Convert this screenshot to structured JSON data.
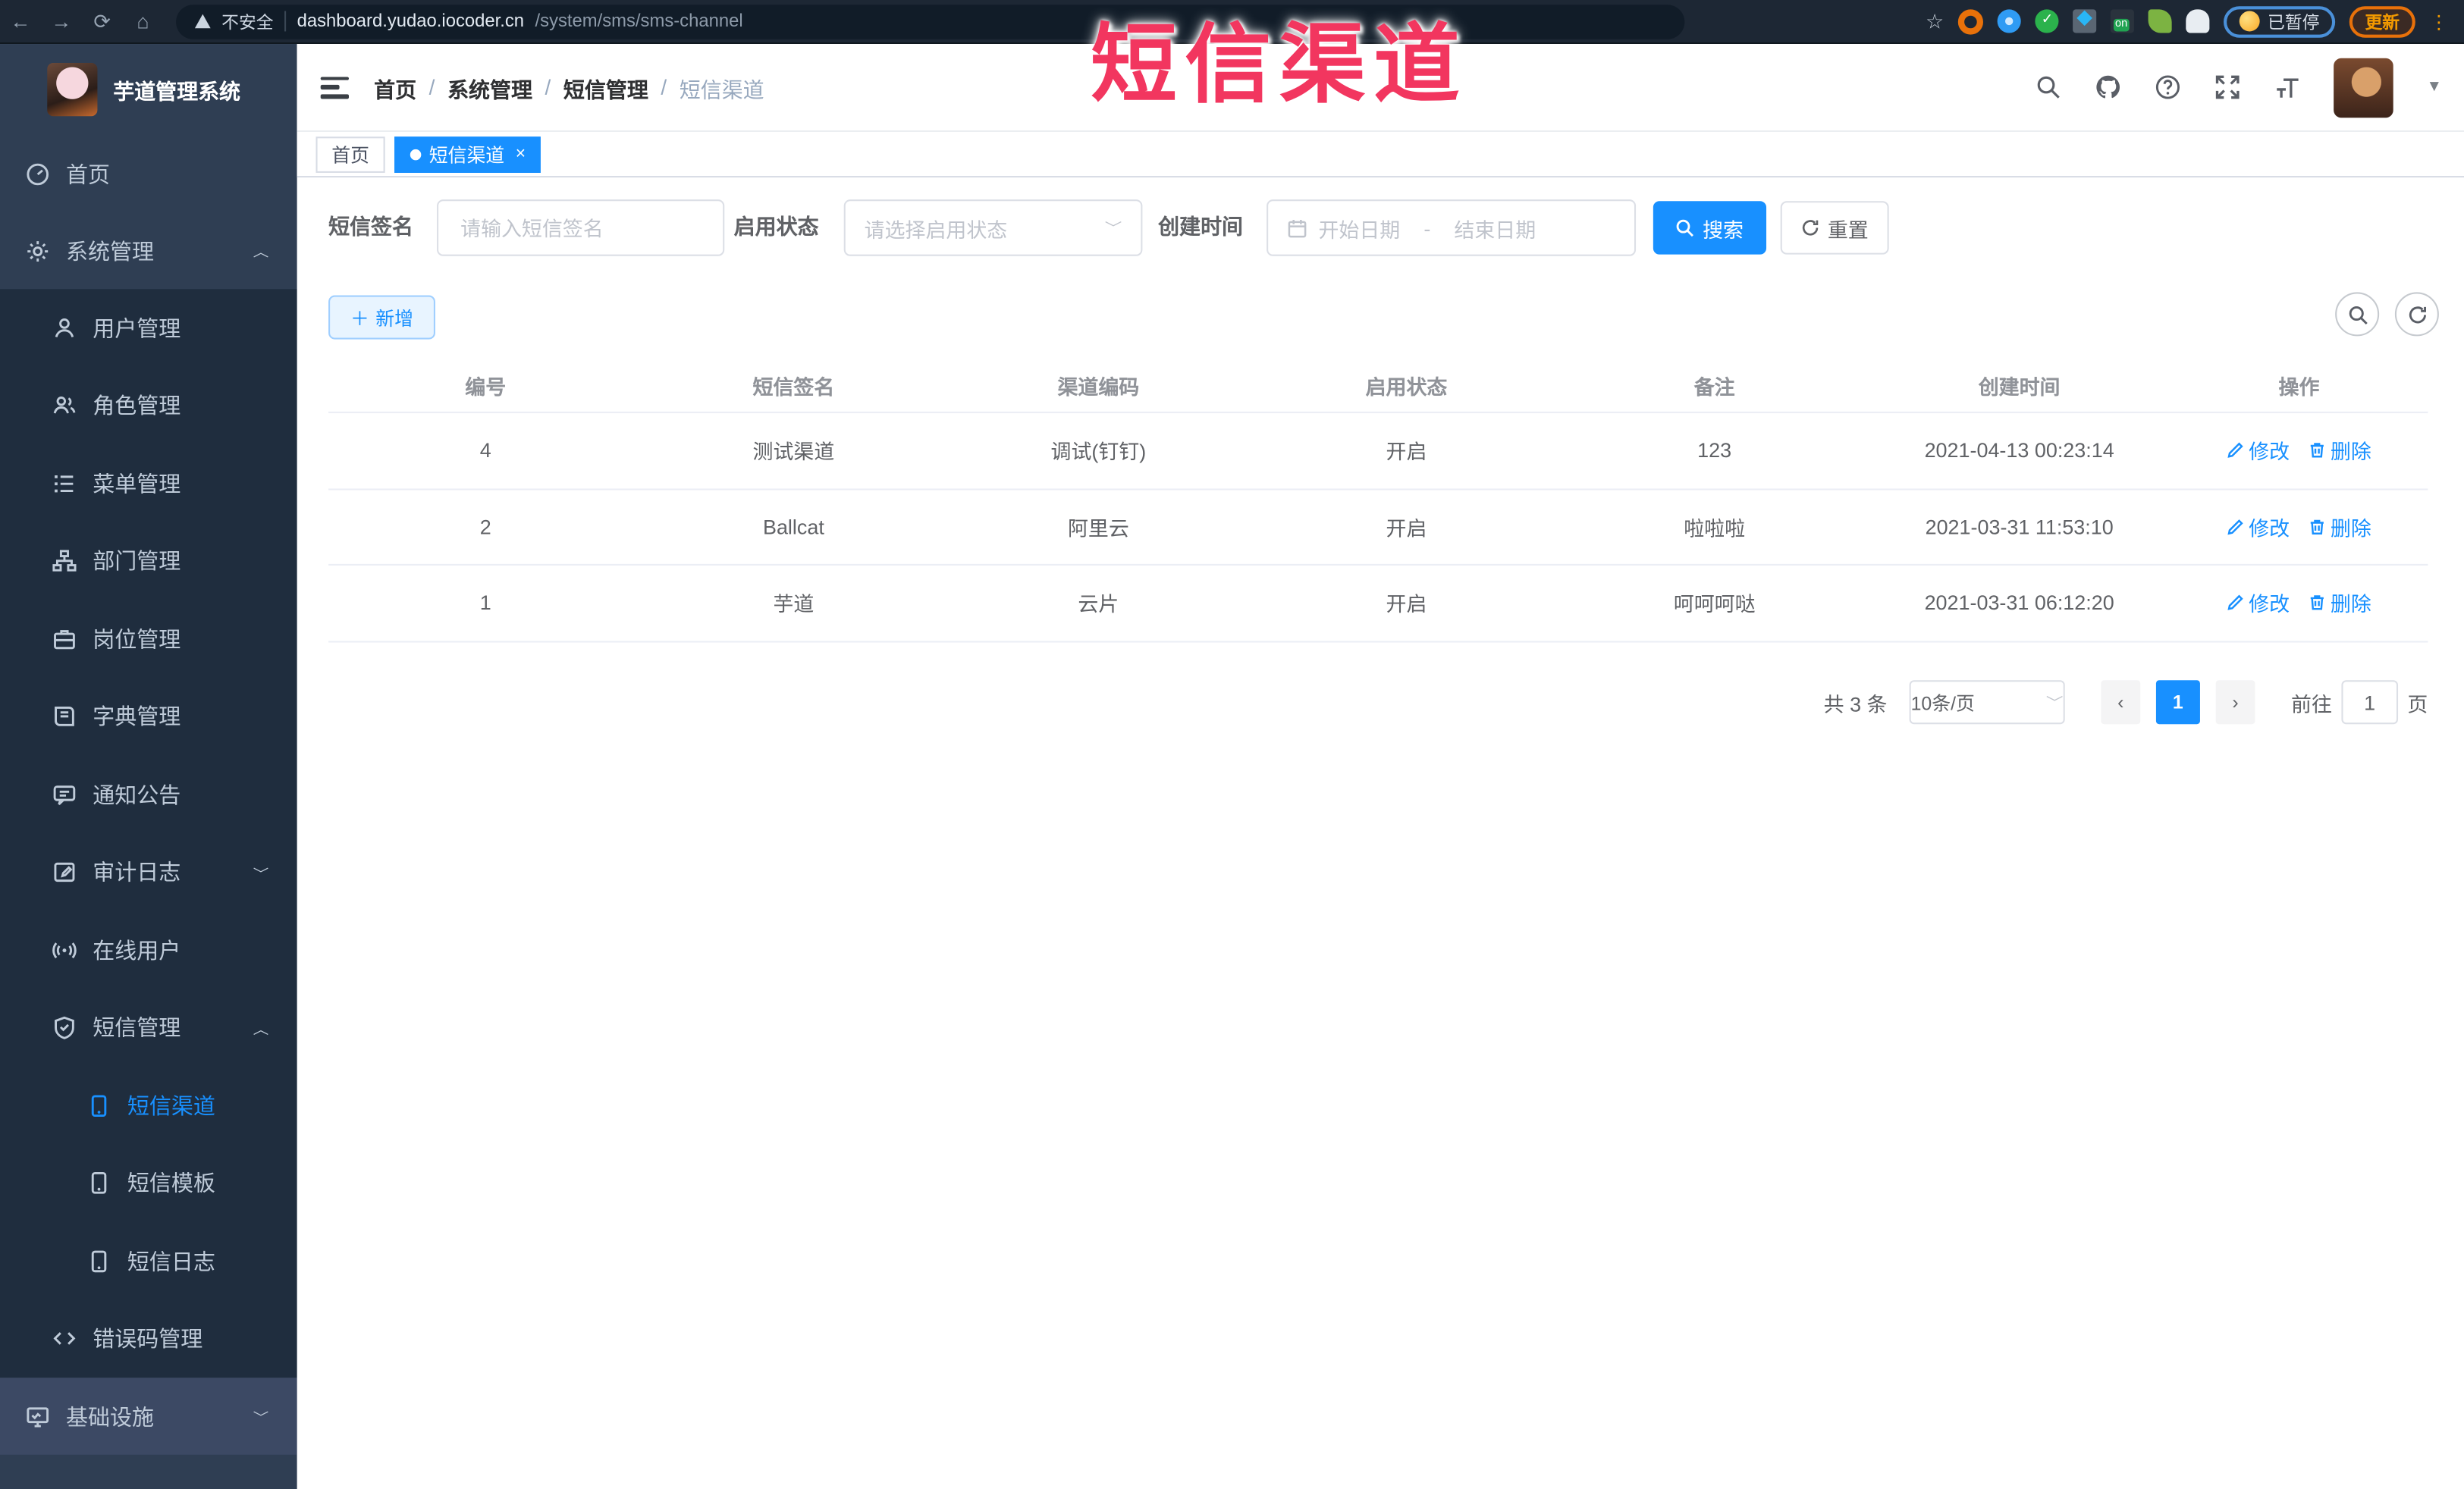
{
  "overlay": {
    "title": "短信渠道",
    "color": "#f2365f"
  },
  "browser": {
    "security_label": "不安全",
    "url_host": "dashboard.yudao.iocoder.cn",
    "url_path": "/system/sms/sms-channel",
    "paused_badge": "已暂停",
    "update_button": "更新"
  },
  "sidebar": {
    "app_title": "芋道管理系统",
    "home_label": "首页",
    "system_label": "系统管理",
    "sub": [
      {
        "label": "用户管理"
      },
      {
        "label": "角色管理"
      },
      {
        "label": "菜单管理"
      },
      {
        "label": "部门管理"
      },
      {
        "label": "岗位管理"
      },
      {
        "label": "字典管理"
      },
      {
        "label": "通知公告"
      },
      {
        "label": "审计日志"
      },
      {
        "label": "在线用户"
      },
      {
        "label": "短信管理"
      }
    ],
    "sms_children": [
      {
        "label": "短信渠道",
        "active": true
      },
      {
        "label": "短信模板"
      },
      {
        "label": "短信日志"
      }
    ],
    "error_code_label": "错误码管理",
    "infra_label": "基础设施"
  },
  "header": {
    "breadcrumb": [
      "首页",
      "系统管理",
      "短信管理",
      "短信渠道"
    ]
  },
  "tabs": [
    {
      "label": "首页"
    },
    {
      "label": "短信渠道"
    }
  ],
  "filters": {
    "sign_label": "短信签名",
    "sign_placeholder": "请输入短信签名",
    "status_label": "启用状态",
    "status_placeholder": "请选择启用状态",
    "date_label": "创建时间",
    "date_start_placeholder": "开始日期",
    "date_separator": "-",
    "date_end_placeholder": "结束日期",
    "search_button": "搜索",
    "reset_button": "重置"
  },
  "toolbar": {
    "add_button": "新增"
  },
  "table": {
    "columns": {
      "id": "编号",
      "sign": "短信签名",
      "code": "渠道编码",
      "status": "启用状态",
      "remark": "备注",
      "created": "创建时间",
      "ops": "操作"
    },
    "actions": {
      "edit": "修改",
      "delete": "删除"
    },
    "rows": [
      {
        "id": "4",
        "sign": "测试渠道",
        "code": "调试(钉钉)",
        "status": "开启",
        "remark": "123",
        "created": "2021-04-13 00:23:14"
      },
      {
        "id": "2",
        "sign": "Ballcat",
        "code": "阿里云",
        "status": "开启",
        "remark": "啦啦啦",
        "created": "2021-03-31 11:53:10"
      },
      {
        "id": "1",
        "sign": "芋道",
        "code": "云片",
        "status": "开启",
        "remark": "呵呵呵哒",
        "created": "2021-03-31 06:12:20"
      }
    ]
  },
  "pagination": {
    "total": "共 3 条",
    "page_size": "10条/页",
    "current_page": "1",
    "goto_label": "前往",
    "goto_value": "1",
    "page_unit": "页"
  },
  "colors": {
    "primary": "#1890ff",
    "sidebar": "#2f3e53",
    "submenu": "#1f2d3e"
  }
}
